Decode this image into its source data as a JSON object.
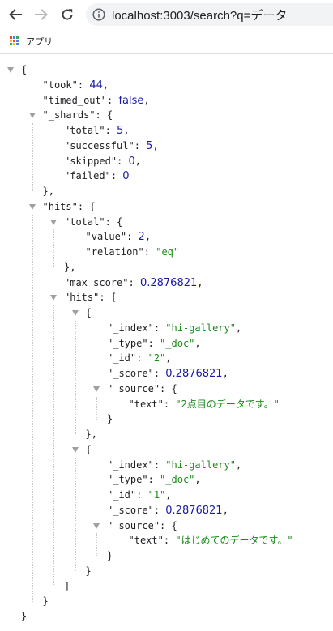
{
  "browser": {
    "url": "localhost:3003/search?q=データ",
    "bookmarks": [
      {
        "label": "アプリ",
        "icon": "apps-grid-icon"
      }
    ],
    "icons": {
      "back": "arrow-left-icon",
      "forward": "arrow-right-icon",
      "reload": "reload-icon",
      "info": "info-icon"
    }
  },
  "json_lines": [
    {
      "depth": 0,
      "text": "{",
      "toggle": true
    },
    {
      "depth": 1,
      "key": "took",
      "value": "44",
      "type": "number",
      "comma": true
    },
    {
      "depth": 1,
      "key": "timed_out",
      "value": "false",
      "type": "boolean",
      "comma": true
    },
    {
      "depth": 1,
      "key": "_shards",
      "text": "{",
      "toggle": true
    },
    {
      "depth": 2,
      "key": "total",
      "value": "5",
      "type": "number",
      "comma": true
    },
    {
      "depth": 2,
      "key": "successful",
      "value": "5",
      "type": "number",
      "comma": true
    },
    {
      "depth": 2,
      "key": "skipped",
      "value": "0",
      "type": "number",
      "comma": true
    },
    {
      "depth": 2,
      "key": "failed",
      "value": "0",
      "type": "number",
      "comma": false
    },
    {
      "depth": 1,
      "text": "},"
    },
    {
      "depth": 1,
      "key": "hits",
      "text": "{",
      "toggle": true
    },
    {
      "depth": 2,
      "key": "total",
      "text": "{",
      "toggle": true
    },
    {
      "depth": 3,
      "key": "value",
      "value": "2",
      "type": "number",
      "comma": true
    },
    {
      "depth": 3,
      "key": "relation",
      "value": "\"eq\"",
      "type": "string",
      "comma": false
    },
    {
      "depth": 2,
      "text": "},"
    },
    {
      "depth": 2,
      "key": "max_score",
      "value": "0.2876821",
      "type": "number",
      "comma": true
    },
    {
      "depth": 2,
      "key": "hits",
      "text": "[",
      "toggle": true
    },
    {
      "depth": 3,
      "text": "{",
      "toggle": true
    },
    {
      "depth": 4,
      "key": "_index",
      "value": "\"hi-gallery\"",
      "type": "string",
      "comma": true
    },
    {
      "depth": 4,
      "key": "_type",
      "value": "\"_doc\"",
      "type": "string",
      "comma": true
    },
    {
      "depth": 4,
      "key": "_id",
      "value": "\"2\"",
      "type": "string",
      "comma": true
    },
    {
      "depth": 4,
      "key": "_score",
      "value": "0.2876821",
      "type": "number",
      "comma": true
    },
    {
      "depth": 4,
      "key": "_source",
      "text": "{",
      "toggle": true
    },
    {
      "depth": 5,
      "key": "text",
      "value": "\"2点目のデータです。\"",
      "type": "string",
      "comma": false
    },
    {
      "depth": 4,
      "text": "}"
    },
    {
      "depth": 3,
      "text": "},"
    },
    {
      "depth": 3,
      "text": "{",
      "toggle": true
    },
    {
      "depth": 4,
      "key": "_index",
      "value": "\"hi-gallery\"",
      "type": "string",
      "comma": true
    },
    {
      "depth": 4,
      "key": "_type",
      "value": "\"_doc\"",
      "type": "string",
      "comma": true
    },
    {
      "depth": 4,
      "key": "_id",
      "value": "\"1\"",
      "type": "string",
      "comma": true
    },
    {
      "depth": 4,
      "key": "_score",
      "value": "0.2876821",
      "type": "number",
      "comma": true
    },
    {
      "depth": 4,
      "key": "_source",
      "text": "{",
      "toggle": true
    },
    {
      "depth": 5,
      "key": "text",
      "value": "\"はじめてのデータです。\"",
      "type": "string",
      "comma": false
    },
    {
      "depth": 4,
      "text": "}"
    },
    {
      "depth": 3,
      "text": "}"
    },
    {
      "depth": 2,
      "text": "]"
    },
    {
      "depth": 1,
      "text": "}"
    },
    {
      "depth": 0,
      "text": "}"
    }
  ],
  "colors": {
    "key": "#202124",
    "string": "#1a8a1a",
    "number": "#1a1aa6",
    "toggle": "#a0a0a0",
    "guide": "#c8c8c8"
  }
}
